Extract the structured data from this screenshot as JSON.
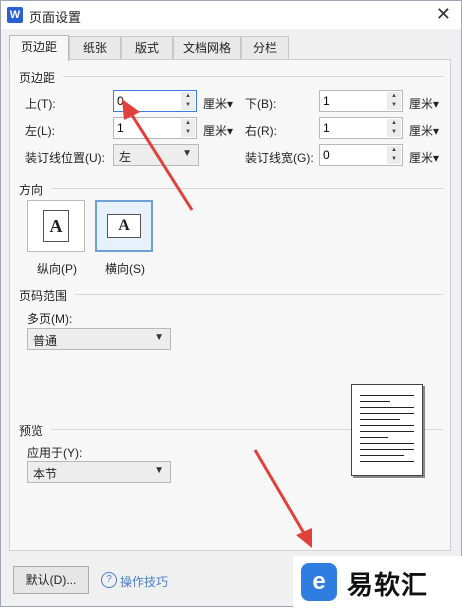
{
  "window": {
    "title": "页面设置",
    "app_icon_glyph": "W",
    "close_glyph": "✕"
  },
  "tabs": [
    {
      "label": "页边距",
      "active": true
    },
    {
      "label": "纸张",
      "active": false
    },
    {
      "label": "版式",
      "active": false
    },
    {
      "label": "文档网格",
      "active": false
    },
    {
      "label": "分栏",
      "active": false
    }
  ],
  "margins": {
    "section_label": "页边距",
    "top_label": "上(T):",
    "top_value": "0",
    "bottom_label": "下(B):",
    "bottom_value": "1",
    "left_label": "左(L):",
    "left_value": "1",
    "right_label": "右(R):",
    "right_value": "1",
    "gutter_pos_label": "装订线位置(U):",
    "gutter_pos_value": "左",
    "gutter_width_label": "装订线宽(G):",
    "gutter_width_value": "0",
    "unit": "厘米▾"
  },
  "orientation": {
    "section_label": "方向",
    "portrait_label": "纵向(P)",
    "landscape_label": "横向(S)",
    "glyph": "A",
    "selected": "landscape"
  },
  "page_range": {
    "section_label": "页码范围",
    "multi_label": "多页(M):",
    "multi_value": "普通"
  },
  "preview": {
    "section_label": "预览",
    "apply_label": "应用于(Y):",
    "apply_value": "本节"
  },
  "footer": {
    "default_button": "默认(D)...",
    "help_icon_glyph": "?",
    "tips_link": "操作技巧"
  },
  "watermark": {
    "icon_glyph": "e",
    "text": "易软汇"
  },
  "colors": {
    "accent": "#4a7fc8",
    "focus_border": "#3c7ee0",
    "annotation_arrow": "#e0413a",
    "watermark_icon": "#2f7de1"
  }
}
